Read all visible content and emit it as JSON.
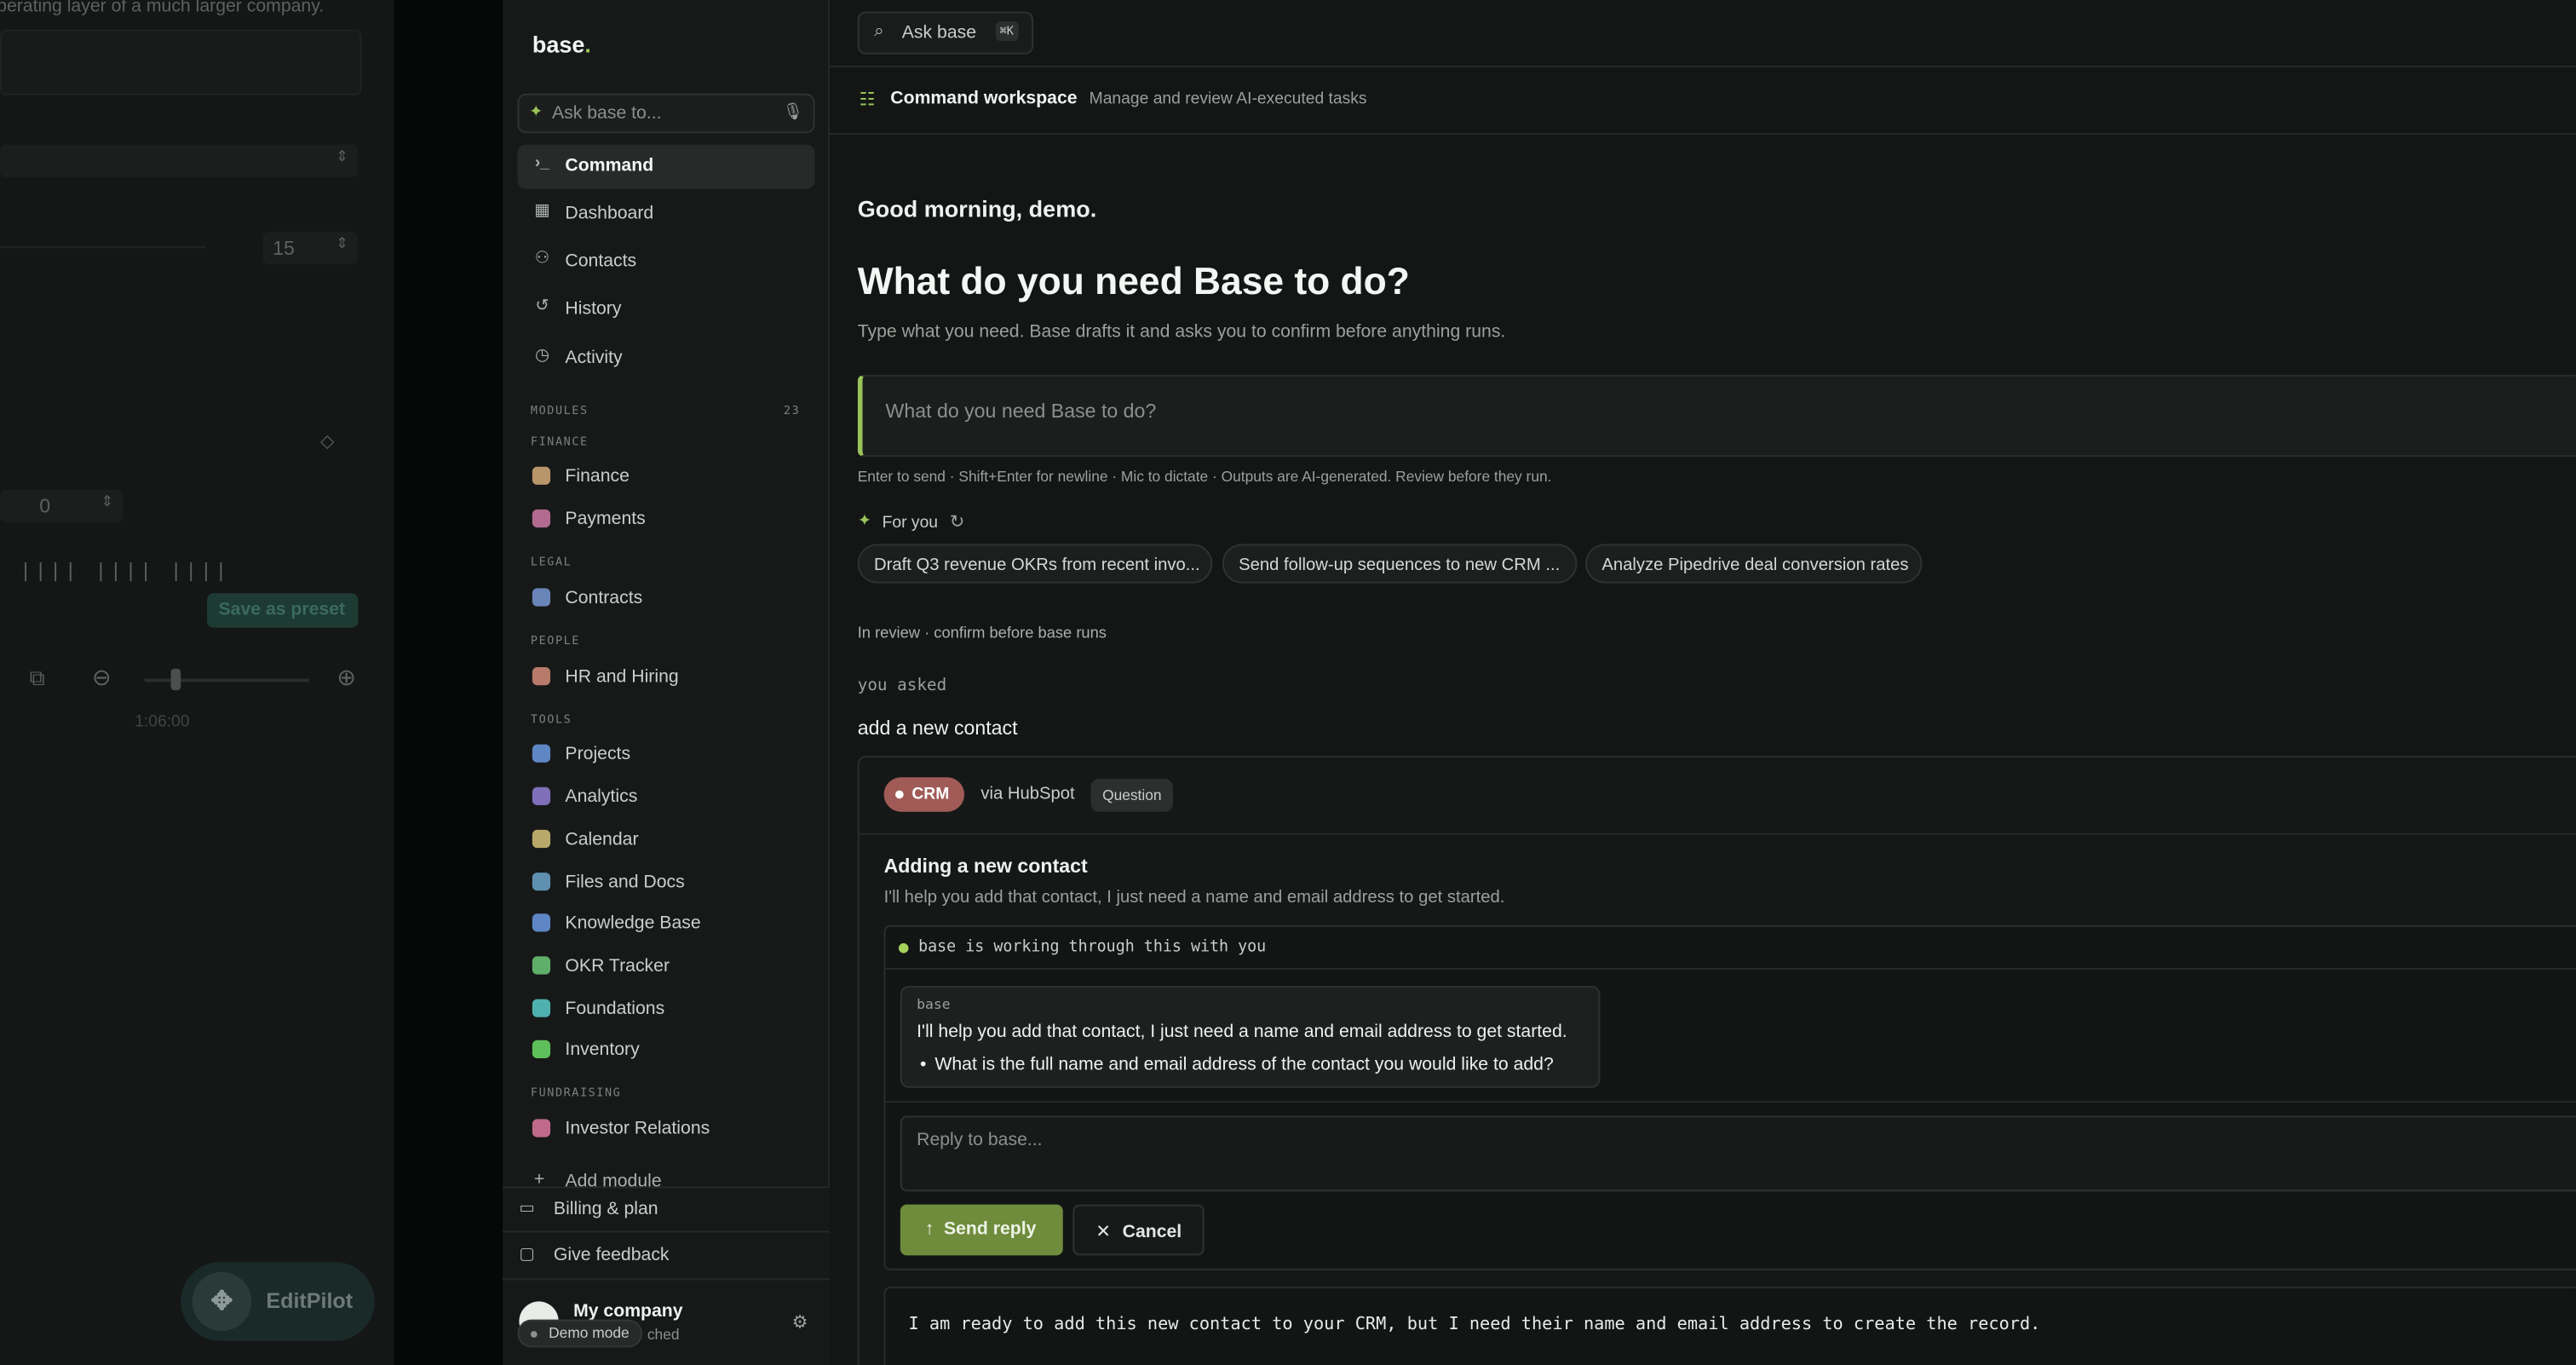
{
  "background_panel": {
    "top_text": "perating layer of a much larger company.",
    "stepper1": "15",
    "stepper2": "0",
    "preset_button": "Save as preset",
    "time": "1:06:00",
    "editpilot": "EditPilot"
  },
  "sidebar": {
    "logo": "base",
    "ask_placeholder": "Ask base to...",
    "nav": [
      {
        "label": "Command",
        "icon": "terminal-icon"
      },
      {
        "label": "Dashboard",
        "icon": "dashboard-icon"
      },
      {
        "label": "Contacts",
        "icon": "contacts-icon"
      },
      {
        "label": "History",
        "icon": "history-icon"
      },
      {
        "label": "Activity",
        "icon": "activity-icon"
      }
    ],
    "modules_label": "MODULES",
    "modules_count": "23",
    "groups": [
      {
        "name": "FINANCE",
        "items": [
          {
            "label": "Finance",
            "color": "#b8956a"
          },
          {
            "label": "Payments",
            "color": "#b36a8f"
          }
        ]
      },
      {
        "name": "LEGAL",
        "items": [
          {
            "label": "Contracts",
            "color": "#6a85b8"
          }
        ]
      },
      {
        "name": "PEOPLE",
        "items": [
          {
            "label": "HR and Hiring",
            "color": "#b87a6a"
          }
        ]
      },
      {
        "name": "TOOLS",
        "items": [
          {
            "label": "Projects",
            "color": "#5f86c4"
          },
          {
            "label": "Analytics",
            "color": "#7f6fb8"
          },
          {
            "label": "Calendar",
            "color": "#b8a86a"
          },
          {
            "label": "Files and Docs",
            "color": "#5f90b0"
          },
          {
            "label": "Knowledge Base",
            "color": "#5f86c4"
          },
          {
            "label": "OKR Tracker",
            "color": "#5fae6a"
          },
          {
            "label": "Foundations",
            "color": "#4fb0b0"
          },
          {
            "label": "Inventory",
            "color": "#5fbf5a"
          }
        ]
      },
      {
        "name": "FUNDRAISING",
        "items": [
          {
            "label": "Investor Relations",
            "color": "#c06a8a"
          }
        ]
      }
    ],
    "add_module": "Add module",
    "footer": {
      "billing": "Billing & plan",
      "feedback": "Give feedback",
      "company": "My company",
      "company_sub": "ched",
      "demo_mode": "Demo mode"
    }
  },
  "main": {
    "search_label": "Ask base",
    "search_kbd": "⌘K",
    "workspace_title": "Command workspace",
    "workspace_sub": "Manage and review AI-executed tasks",
    "greeting": "Good morning, demo.",
    "heading": "What do you need Base to do?",
    "subheading": "Type what you need. Base drafts it and asks you to confirm before anything runs.",
    "composer_placeholder": "What do you need Base to do?",
    "hint": "Enter to send · Shift+Enter for newline · Mic to dictate · Outputs are AI-generated. Review before they run.",
    "for_you": "For you",
    "chips": [
      "Draft Q3 revenue OKRs from recent invo...",
      "Send follow-up sequences to new CRM ...",
      "Analyze Pipedrive deal conversion rates"
    ],
    "review_label": "In review · confirm before base runs",
    "you_asked": "you asked",
    "request": "add a new contact",
    "card": {
      "badge": "CRM",
      "via": "via HubSpot",
      "tag": "Question",
      "title": "Adding a new contact",
      "desc": "I'll help you add that contact, I just need a name and email address to get started.",
      "status": "base is working through this with you",
      "bubble_author": "base",
      "bubble_text": "I'll help you add that contact, I just need a name and email address to get started.",
      "bubble_bullet": "What is the full name and email address of the contact you would like to add?",
      "reply_placeholder": "Reply to base...",
      "send": "Send reply",
      "cancel": "Cancel",
      "output": "I am ready to add this new contact to your CRM, but I need their name and email address to create the record."
    }
  }
}
